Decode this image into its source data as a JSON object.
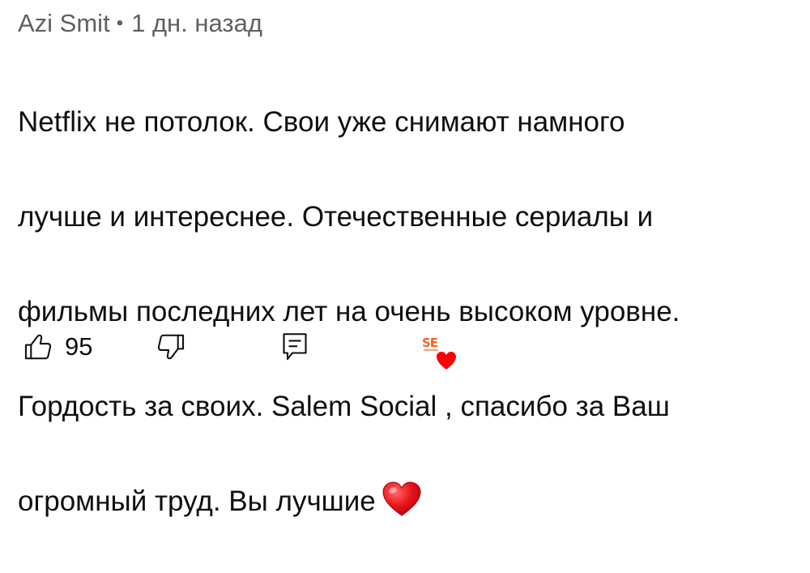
{
  "comment": {
    "author": "Azi Smit",
    "separator": "•",
    "timestamp": "1 дн. назад",
    "lines": [
      "Netflix не потолок. Свои уже снимают намного",
      "лучше и интереснее. Отечественные сериалы и",
      "фильмы последних лет на очень высоком уровне.",
      "Гордость за своих. Salem Social , спасибо за Ваш",
      "огромный труд. Вы лучшие"
    ],
    "emoji": "red-heart-emoji"
  },
  "actions": {
    "like_icon": "thumbs-up-icon",
    "like_count": "95",
    "dislike_icon": "thumbs-down-icon",
    "reply_icon": "reply-comment-icon",
    "creator_heart": {
      "avatar_text": "SE",
      "heart_color": "#ff0000",
      "text_color": "#f26522"
    }
  },
  "colors": {
    "meta_text": "#606060",
    "body_text": "#0f0f0f",
    "background": "#ffffff"
  }
}
